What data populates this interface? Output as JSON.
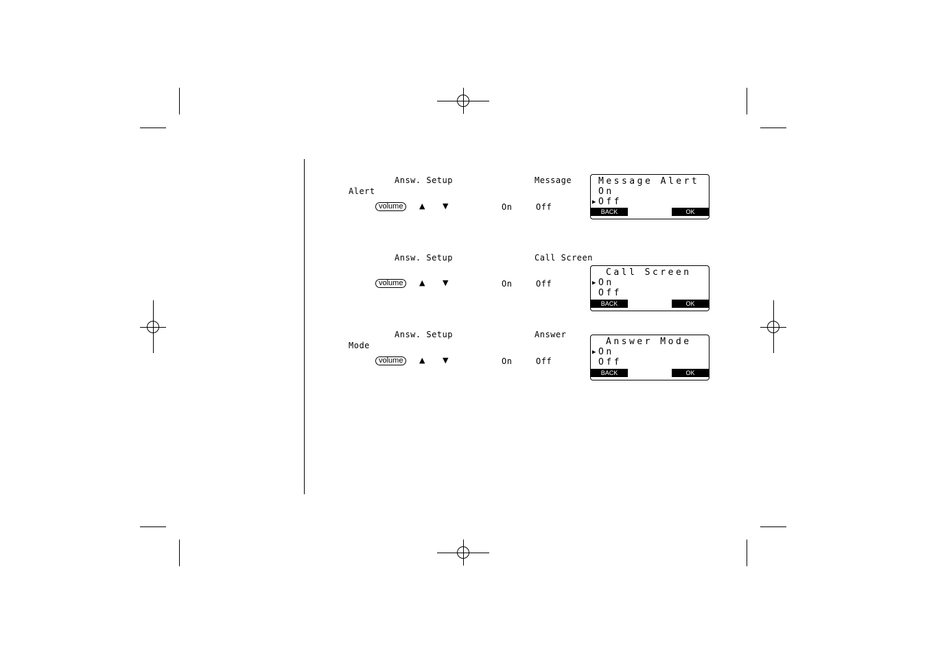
{
  "sections": [
    {
      "menu": "Answ. Setup",
      "item_line1": "Message",
      "item_line2": "Alert",
      "key": "volume",
      "up": "▲",
      "down": "▼",
      "opt_on": "On",
      "opt_off": "Off",
      "screen": {
        "title": "Message Alert",
        "line1": "On",
        "line2": "Off",
        "selected": "Off",
        "back": "BACK",
        "ok": "OK"
      }
    },
    {
      "menu": "Answ. Setup",
      "item_line1": "Call Screen",
      "item_line2": "",
      "key": "volume",
      "up": "▲",
      "down": "▼",
      "opt_on": "On",
      "opt_off": "Off",
      "screen": {
        "title": "Call Screen",
        "line1": "On",
        "line2": "Off",
        "selected": "On",
        "back": "BACK",
        "ok": "OK"
      }
    },
    {
      "menu": "Answ. Setup",
      "item_line1": "Answer",
      "item_line2": "Mode",
      "key": "volume",
      "up": "▲",
      "down": "▼",
      "opt_on": "On",
      "opt_off": "Off",
      "screen": {
        "title": "Answer Mode",
        "line1": "On",
        "line2": "Off",
        "selected": "On",
        "back": "BACK",
        "ok": "OK"
      }
    }
  ],
  "pointer_glyph": "▶"
}
